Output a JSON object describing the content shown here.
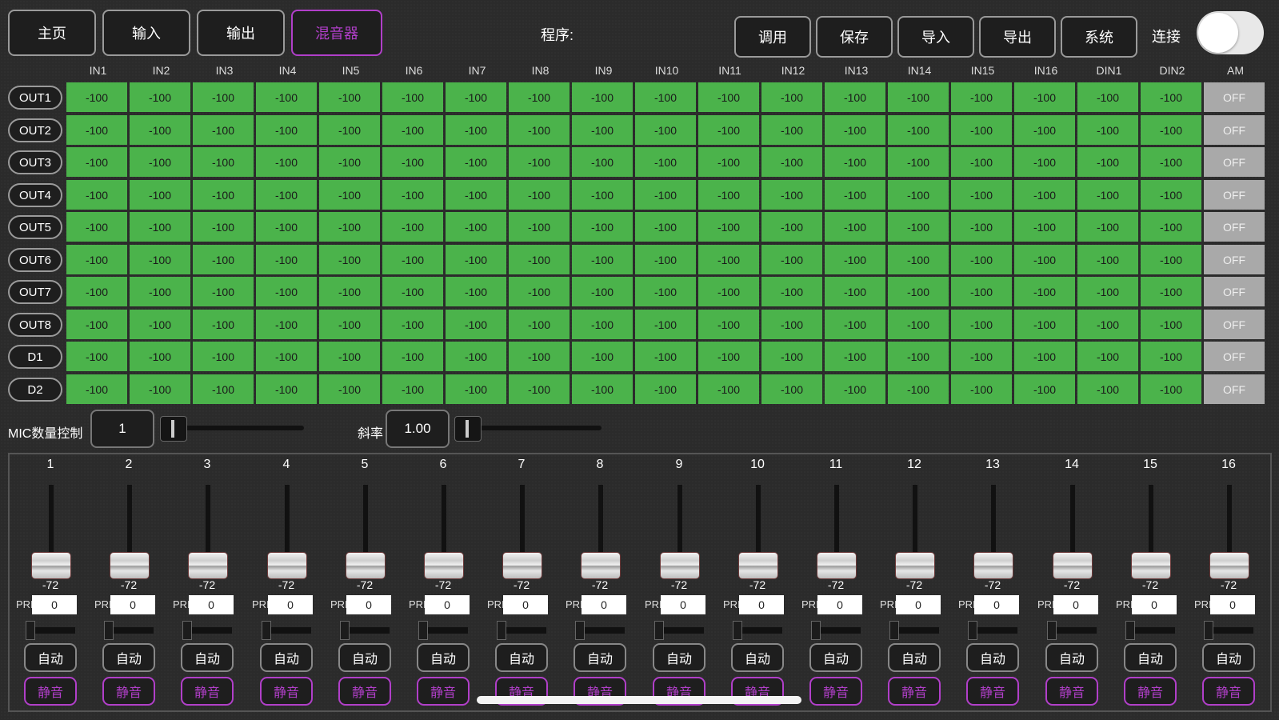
{
  "nav": {
    "tabs": [
      "主页",
      "输入",
      "输出",
      "混音器"
    ],
    "active_tab": 3
  },
  "program": {
    "label": "程序:"
  },
  "actions": [
    "调用",
    "保存",
    "导入",
    "导出",
    "系统"
  ],
  "connection": {
    "label": "连接",
    "toggle_on": false
  },
  "matrix": {
    "columns": [
      "IN1",
      "IN2",
      "IN3",
      "IN4",
      "IN5",
      "IN6",
      "IN7",
      "IN8",
      "IN9",
      "IN10",
      "IN11",
      "IN12",
      "IN13",
      "IN14",
      "IN15",
      "IN16",
      "DIN1",
      "DIN2",
      "AM"
    ],
    "rows": [
      {
        "label": "OUT1",
        "values": [
          "-100",
          "-100",
          "-100",
          "-100",
          "-100",
          "-100",
          "-100",
          "-100",
          "-100",
          "-100",
          "-100",
          "-100",
          "-100",
          "-100",
          "-100",
          "-100",
          "-100",
          "-100",
          "OFF"
        ]
      },
      {
        "label": "OUT2",
        "values": [
          "-100",
          "-100",
          "-100",
          "-100",
          "-100",
          "-100",
          "-100",
          "-100",
          "-100",
          "-100",
          "-100",
          "-100",
          "-100",
          "-100",
          "-100",
          "-100",
          "-100",
          "-100",
          "OFF"
        ]
      },
      {
        "label": "OUT3",
        "values": [
          "-100",
          "-100",
          "-100",
          "-100",
          "-100",
          "-100",
          "-100",
          "-100",
          "-100",
          "-100",
          "-100",
          "-100",
          "-100",
          "-100",
          "-100",
          "-100",
          "-100",
          "-100",
          "OFF"
        ]
      },
      {
        "label": "OUT4",
        "values": [
          "-100",
          "-100",
          "-100",
          "-100",
          "-100",
          "-100",
          "-100",
          "-100",
          "-100",
          "-100",
          "-100",
          "-100",
          "-100",
          "-100",
          "-100",
          "-100",
          "-100",
          "-100",
          "OFF"
        ]
      },
      {
        "label": "OUT5",
        "values": [
          "-100",
          "-100",
          "-100",
          "-100",
          "-100",
          "-100",
          "-100",
          "-100",
          "-100",
          "-100",
          "-100",
          "-100",
          "-100",
          "-100",
          "-100",
          "-100",
          "-100",
          "-100",
          "OFF"
        ]
      },
      {
        "label": "OUT6",
        "values": [
          "-100",
          "-100",
          "-100",
          "-100",
          "-100",
          "-100",
          "-100",
          "-100",
          "-100",
          "-100",
          "-100",
          "-100",
          "-100",
          "-100",
          "-100",
          "-100",
          "-100",
          "-100",
          "OFF"
        ]
      },
      {
        "label": "OUT7",
        "values": [
          "-100",
          "-100",
          "-100",
          "-100",
          "-100",
          "-100",
          "-100",
          "-100",
          "-100",
          "-100",
          "-100",
          "-100",
          "-100",
          "-100",
          "-100",
          "-100",
          "-100",
          "-100",
          "OFF"
        ]
      },
      {
        "label": "OUT8",
        "values": [
          "-100",
          "-100",
          "-100",
          "-100",
          "-100",
          "-100",
          "-100",
          "-100",
          "-100",
          "-100",
          "-100",
          "-100",
          "-100",
          "-100",
          "-100",
          "-100",
          "-100",
          "-100",
          "OFF"
        ]
      },
      {
        "label": "D1",
        "values": [
          "-100",
          "-100",
          "-100",
          "-100",
          "-100",
          "-100",
          "-100",
          "-100",
          "-100",
          "-100",
          "-100",
          "-100",
          "-100",
          "-100",
          "-100",
          "-100",
          "-100",
          "-100",
          "OFF"
        ]
      },
      {
        "label": "D2",
        "values": [
          "-100",
          "-100",
          "-100",
          "-100",
          "-100",
          "-100",
          "-100",
          "-100",
          "-100",
          "-100",
          "-100",
          "-100",
          "-100",
          "-100",
          "-100",
          "-100",
          "-100",
          "-100",
          "OFF"
        ]
      }
    ]
  },
  "controls": {
    "mic_label": "MIC数量控制",
    "mic_value": "1",
    "slope_label": "斜率",
    "slope_value": "1.00"
  },
  "channels": [
    {
      "num": "1",
      "db": "-72",
      "pri_label": "PRI",
      "pri": "0",
      "auto": "自动",
      "mute": "静音"
    },
    {
      "num": "2",
      "db": "-72",
      "pri_label": "PRI",
      "pri": "0",
      "auto": "自动",
      "mute": "静音"
    },
    {
      "num": "3",
      "db": "-72",
      "pri_label": "PRI",
      "pri": "0",
      "auto": "自动",
      "mute": "静音"
    },
    {
      "num": "4",
      "db": "-72",
      "pri_label": "PRI",
      "pri": "0",
      "auto": "自动",
      "mute": "静音"
    },
    {
      "num": "5",
      "db": "-72",
      "pri_label": "PRI",
      "pri": "0",
      "auto": "自动",
      "mute": "静音"
    },
    {
      "num": "6",
      "db": "-72",
      "pri_label": "PRI",
      "pri": "0",
      "auto": "自动",
      "mute": "静音"
    },
    {
      "num": "7",
      "db": "-72",
      "pri_label": "PRI",
      "pri": "0",
      "auto": "自动",
      "mute": "静音"
    },
    {
      "num": "8",
      "db": "-72",
      "pri_label": "PRI",
      "pri": "0",
      "auto": "自动",
      "mute": "静音"
    },
    {
      "num": "9",
      "db": "-72",
      "pri_label": "PRI",
      "pri": "0",
      "auto": "自动",
      "mute": "静音"
    },
    {
      "num": "10",
      "db": "-72",
      "pri_label": "PRI",
      "pri": "0",
      "auto": "自动",
      "mute": "静音"
    },
    {
      "num": "11",
      "db": "-72",
      "pri_label": "PRI",
      "pri": "0",
      "auto": "自动",
      "mute": "静音"
    },
    {
      "num": "12",
      "db": "-72",
      "pri_label": "PRI",
      "pri": "0",
      "auto": "自动",
      "mute": "静音"
    },
    {
      "num": "13",
      "db": "-72",
      "pri_label": "PRI",
      "pri": "0",
      "auto": "自动",
      "mute": "静音"
    },
    {
      "num": "14",
      "db": "-72",
      "pri_label": "PRI",
      "pri": "0",
      "auto": "自动",
      "mute": "静音"
    },
    {
      "num": "15",
      "db": "-72",
      "pri_label": "PRI",
      "pri": "0",
      "auto": "自动",
      "mute": "静音"
    },
    {
      "num": "16",
      "db": "-72",
      "pri_label": "PRI",
      "pri": "0",
      "auto": "自动",
      "mute": "静音"
    }
  ],
  "colors": {
    "cell_green": "#4bb34b",
    "cell_off": "#a9a9a9",
    "accent_purple": "#b13fc9",
    "background": "#2b2b2b"
  }
}
